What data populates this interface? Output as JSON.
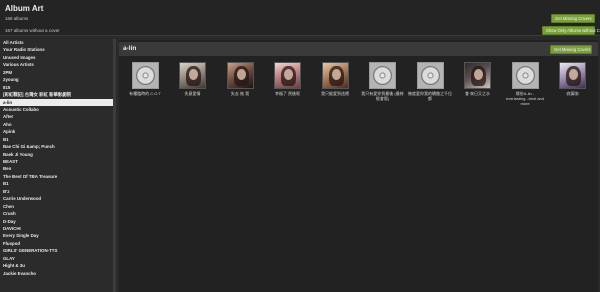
{
  "header": {
    "title": "Album Art",
    "album_count": "168 albums",
    "missing_count": "167 albums without a cover",
    "get_missing_label": "Get Missing Covers",
    "show_missing_label": "Show Only Albums without Covers"
  },
  "sidebar": {
    "artists": [
      "All Artists",
      "Your Radio Stations",
      "Unused Images",
      "Various Artists",
      "2PM",
      "2young",
      "815",
      "[彩虹戰記] 台灣女 彩虹 新華影劇院",
      "a-lin",
      "Acoustic Collabo",
      "After",
      "Ahn",
      "Apink",
      "B1",
      "Bae Chi Gi &amp; Punch",
      "Baek Ji Young",
      "BEAST",
      "Ben",
      "The Best Of TBA Treasure",
      "B1",
      "B'z",
      "Carrie Underwood",
      "Chen",
      "Crush",
      "D-Day",
      "DAVICHI",
      "Every Single Day",
      "Fluxpod",
      "GIRLS' GENERATION-TTS",
      "GLAY",
      "Hight & 3u",
      "Jackie Evancho"
    ],
    "active_index": 8
  },
  "main": {
    "title": "a-lin",
    "get_missing_label": "Get Missing Covers",
    "albums": [
      {
        "title": "有種臨時的 C.O.T",
        "art": "cd"
      },
      {
        "title": "失意愛情",
        "art": "photo1"
      },
      {
        "title": "失去 她 我",
        "art": "photo2"
      },
      {
        "title": "幸福了 然後呢",
        "art": "photo3"
      },
      {
        "title": "我只能愛到這裡",
        "art": "photo4"
      },
      {
        "title": "我只有愛你到最後 (最終極會版)",
        "art": "cd"
      },
      {
        "title": "幾度愛你我的驕傲之千位都",
        "art": "cd"
      },
      {
        "title": "會 來日又之水",
        "art": "photo5"
      },
      {
        "title": "緣份A-lin - everlasting...best and more",
        "art": "cd"
      },
      {
        "title": "寂寞咖",
        "art": "photo6"
      }
    ]
  },
  "colors": {
    "button": "#7aa03c",
    "background": "#2a2a2a",
    "selected": "#ececec"
  }
}
